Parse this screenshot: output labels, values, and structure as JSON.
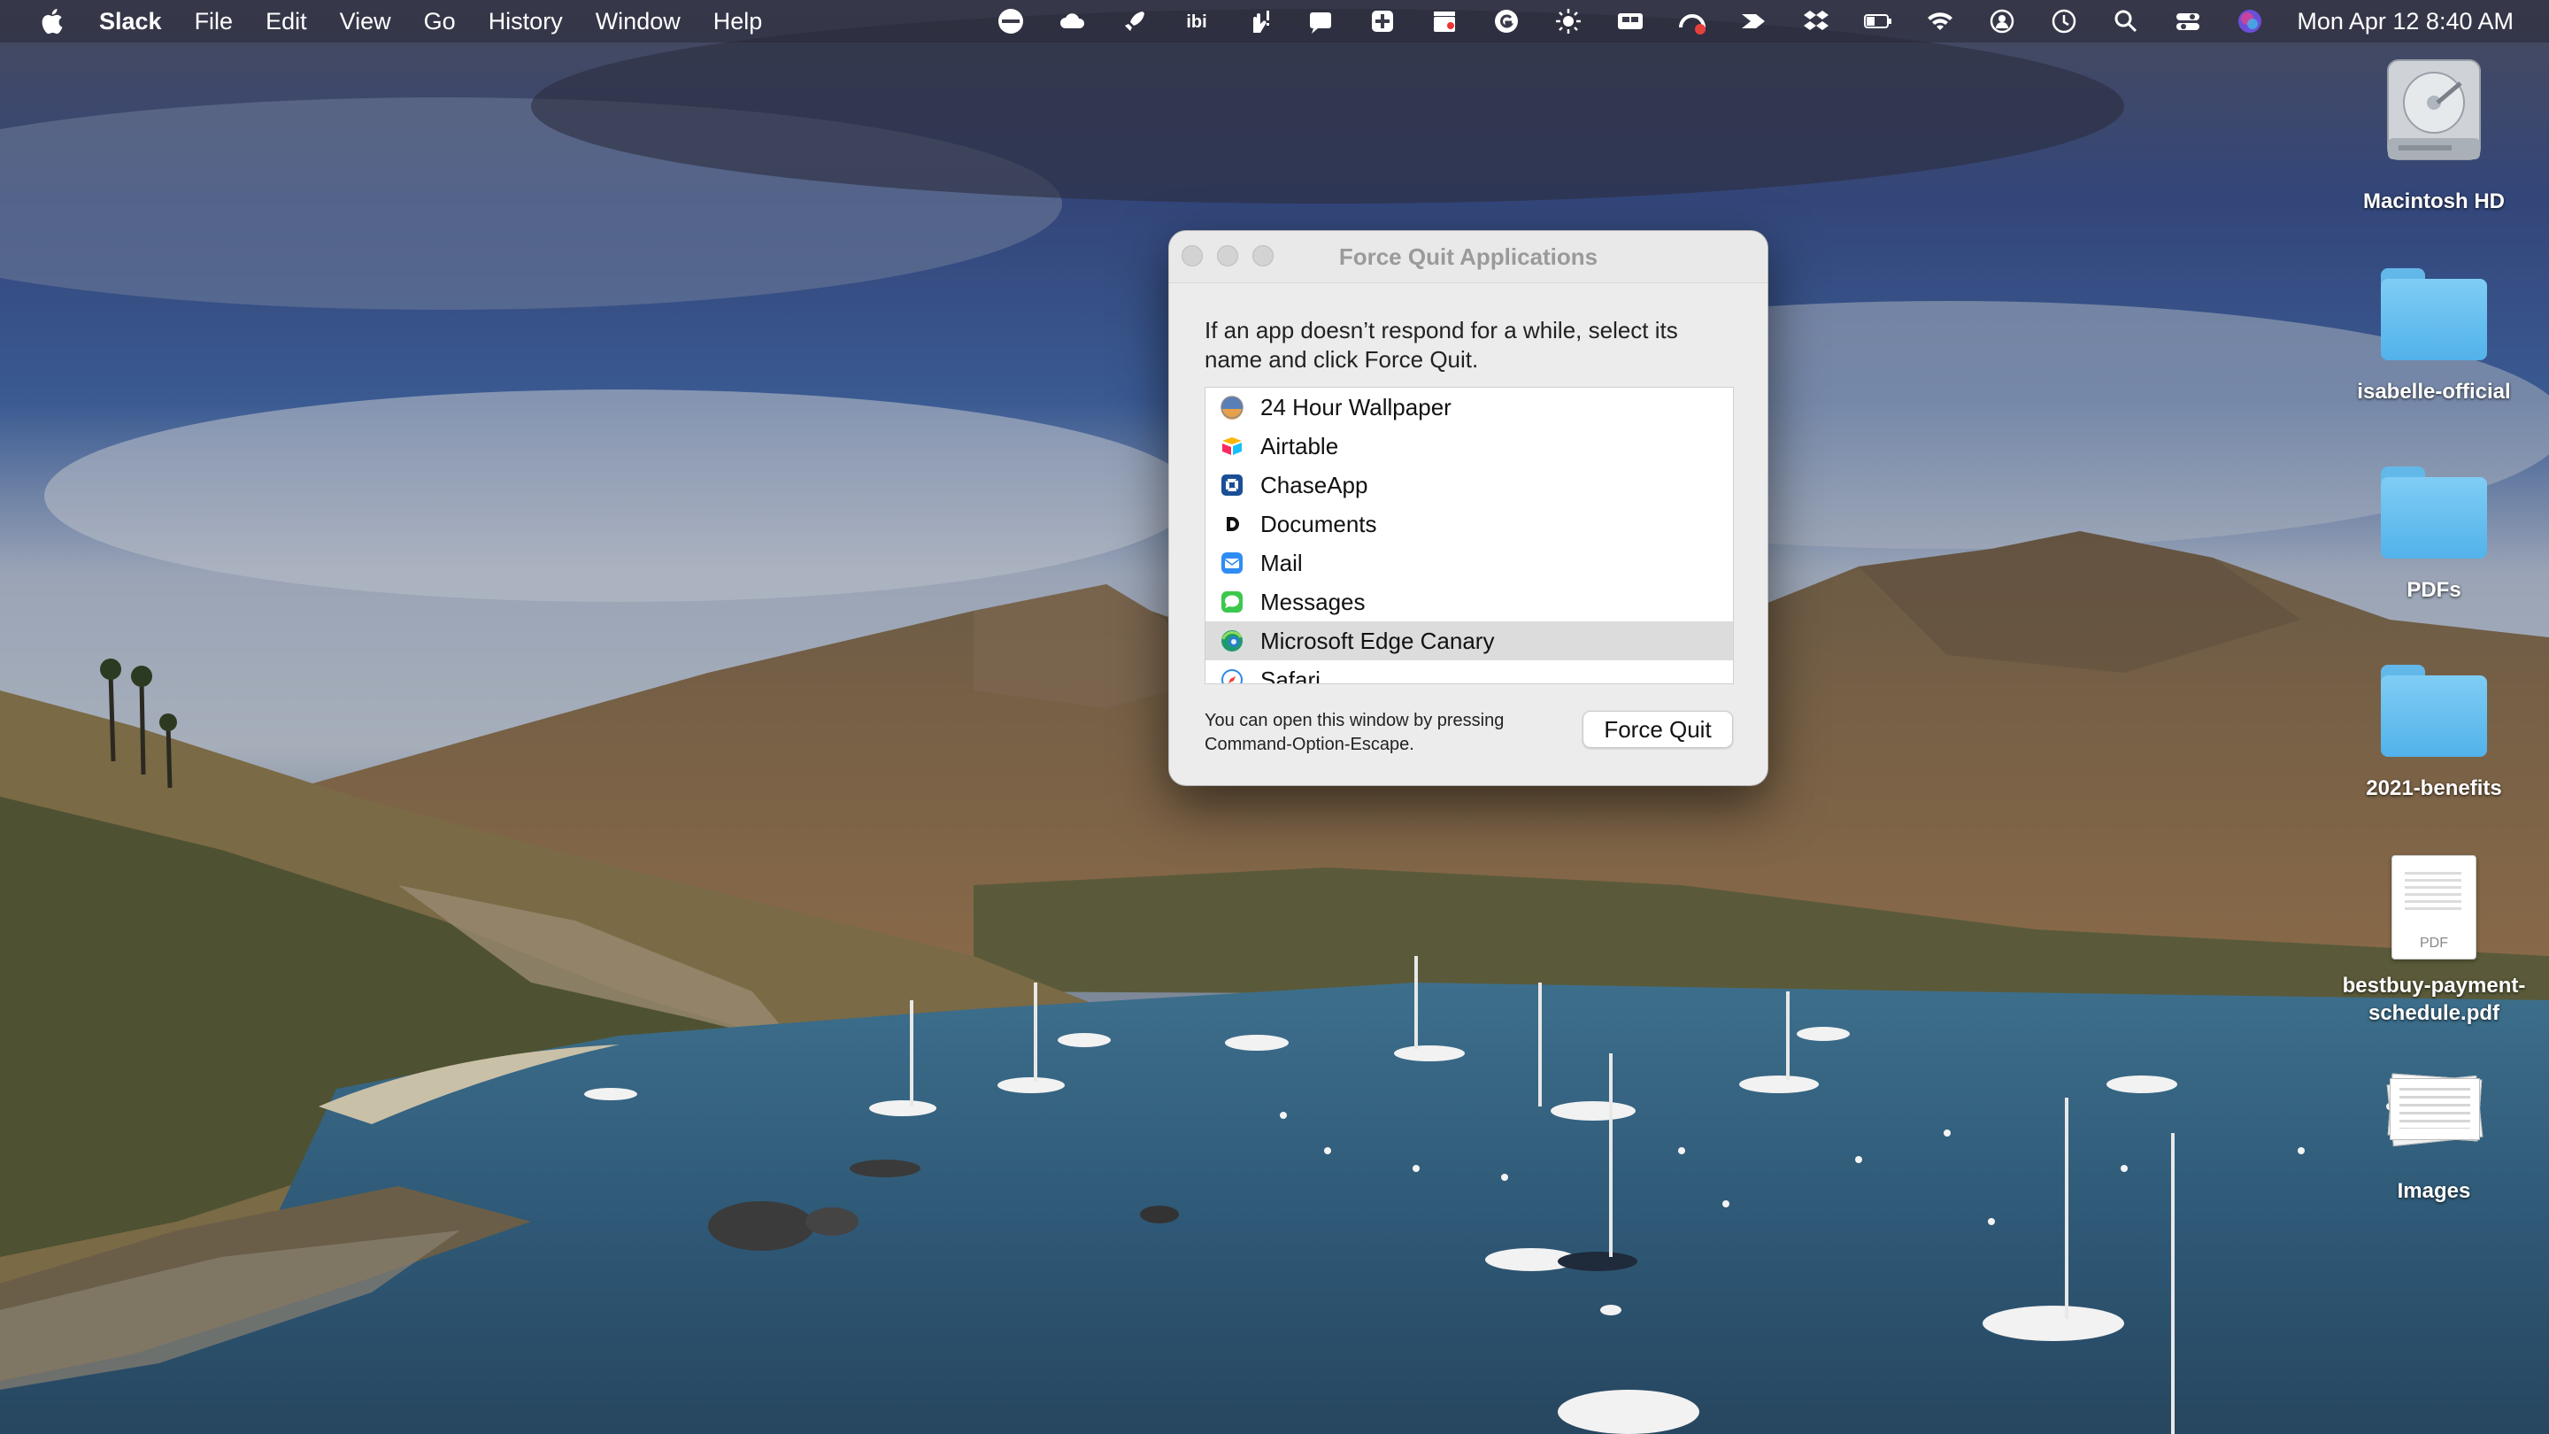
{
  "menubar": {
    "app_name": "Slack",
    "menus": [
      "File",
      "Edit",
      "View",
      "Go",
      "History",
      "Window",
      "Help"
    ],
    "clock": "Mon Apr 12  8:40 AM"
  },
  "desktop": {
    "items": [
      {
        "label": "Macintosh HD",
        "kind": "drive"
      },
      {
        "label": "isabelle-official",
        "kind": "folder"
      },
      {
        "label": "PDFs",
        "kind": "folder"
      },
      {
        "label": "2021-benefits",
        "kind": "folder"
      },
      {
        "label": "bestbuy-payment-schedule.pdf",
        "kind": "pdf",
        "badge": "PDF"
      },
      {
        "label": "Images",
        "kind": "images"
      }
    ]
  },
  "force_quit": {
    "title": "Force Quit Applications",
    "description": "If an app doesn’t respond for a while, select its name and click Force Quit.",
    "apps": [
      {
        "name": "24 Hour Wallpaper",
        "icon": "wallpaper-icon"
      },
      {
        "name": "Airtable",
        "icon": "airtable-icon"
      },
      {
        "name": "ChaseApp",
        "icon": "chase-icon"
      },
      {
        "name": "Documents",
        "icon": "documents-icon"
      },
      {
        "name": "Mail",
        "icon": "mail-icon"
      },
      {
        "name": "Messages",
        "icon": "messages-icon"
      },
      {
        "name": "Microsoft Edge Canary",
        "icon": "edge-canary-icon",
        "selected": true
      },
      {
        "name": "Safari",
        "icon": "safari-icon"
      }
    ],
    "hint": "You can open this window by pressing Command-Option-Escape.",
    "button_label": "Force Quit"
  }
}
